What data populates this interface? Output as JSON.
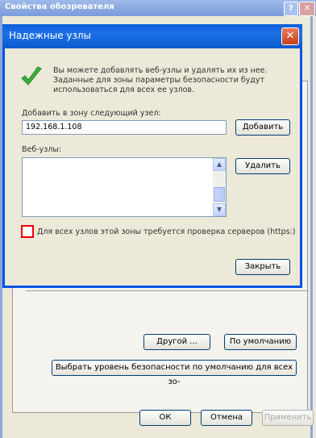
{
  "outer": {
    "title": "Свойства обозревателя",
    "help_label": "?",
    "close_label": "✕",
    "other_label": "Другой ...",
    "default_label": "По умолчанию",
    "reset_all_label": "Выбрать уровень безопасности по умолчанию для всех зо-",
    "ok_label": "ОК",
    "cancel_label": "Отмена",
    "apply_label": "Применить"
  },
  "dialog": {
    "title": "Надежные узлы",
    "close_label": "✕",
    "info_text": "Вы можете добавлять веб-узлы и удалять их из нее. Заданные для зоны параметры безопасности будут использоваться для всех ее узлов.",
    "add_label": "Добавить в зону следующий узел:",
    "add_value": "192.168.1.108",
    "add_button": "Добавить",
    "websites_label": "Веб-узлы:",
    "remove_button": "Удалить",
    "https_label": "Для всех узлов этой зоны требуется проверка серверов (https:)",
    "close_button": "Закрыть",
    "https_checked": false
  },
  "icons": {
    "check": "checkmark-icon",
    "up": "scroll-up-icon",
    "down": "scroll-down-icon"
  }
}
